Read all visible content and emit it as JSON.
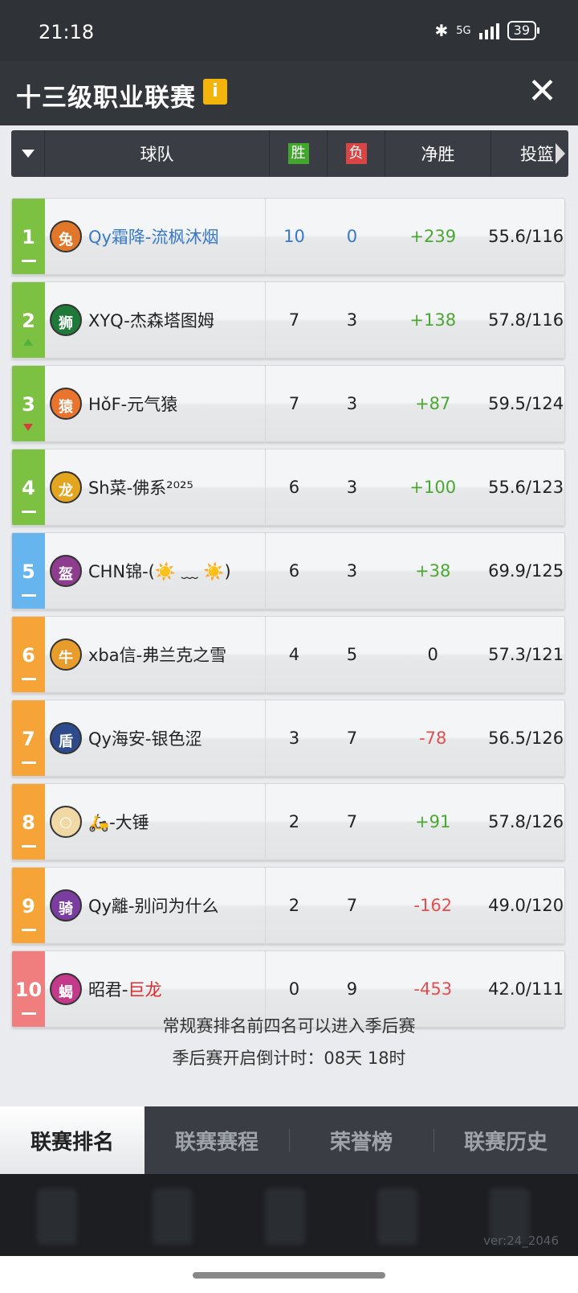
{
  "status": {
    "time": "21:18",
    "network": "5G",
    "battery": "39"
  },
  "header": {
    "title": "十三级职业联赛",
    "info_label": "i"
  },
  "table_header": {
    "team": "球队",
    "win": "胜",
    "loss": "负",
    "net": "净胜",
    "shoot": "投篮"
  },
  "teams": [
    {
      "rank": "1",
      "name": "Qy霜降-流枫沐烟",
      "name_suffix": "",
      "win": "10",
      "loss": "0",
      "net": "+239",
      "shoot": "55.6/116",
      "rank_color": "green",
      "trend": "same",
      "logo_color": "#e0772b",
      "logo_glyph": "兔"
    },
    {
      "rank": "2",
      "name": "XYQ-杰森塔图姆",
      "name_suffix": "",
      "win": "7",
      "loss": "3",
      "net": "+138",
      "shoot": "57.8/116",
      "rank_color": "green",
      "trend": "up",
      "logo_color": "#1f7a3a",
      "logo_glyph": "狮"
    },
    {
      "rank": "3",
      "name": "HǒF-元气猿",
      "name_suffix": "",
      "win": "7",
      "loss": "3",
      "net": "+87",
      "shoot": "59.5/124",
      "rank_color": "green",
      "trend": "down",
      "logo_color": "#e8742e",
      "logo_glyph": "猿"
    },
    {
      "rank": "4",
      "name": "Sh菜-佛系²⁰²⁵",
      "name_suffix": "",
      "win": "6",
      "loss": "3",
      "net": "+100",
      "shoot": "55.6/123",
      "rank_color": "green",
      "trend": "same",
      "logo_color": "#e3a51f",
      "logo_glyph": "龙"
    },
    {
      "rank": "5",
      "name": "CHN锦-(☀️ ﹏ ☀️)",
      "name_suffix": "",
      "win": "6",
      "loss": "3",
      "net": "+38",
      "shoot": "69.9/125",
      "rank_color": "blue",
      "trend": "same",
      "logo_color": "#8e3c8e",
      "logo_glyph": "盔"
    },
    {
      "rank": "6",
      "name": "xba信-弗兰克之雪",
      "name_suffix": "",
      "win": "4",
      "loss": "5",
      "net": "0",
      "shoot": "57.3/121",
      "rank_color": "orange",
      "trend": "same",
      "logo_color": "#e89c2c",
      "logo_glyph": "牛"
    },
    {
      "rank": "7",
      "name": "Qy海安-银色涩",
      "name_suffix": "",
      "win": "3",
      "loss": "7",
      "net": "-78",
      "shoot": "56.5/126",
      "rank_color": "orange",
      "trend": "same",
      "logo_color": "#2d4a8c",
      "logo_glyph": "盾"
    },
    {
      "rank": "8",
      "name": "🛵-大锤",
      "name_suffix": "",
      "win": "2",
      "loss": "7",
      "net": "+91",
      "shoot": "57.8/126",
      "rank_color": "orange",
      "trend": "same",
      "logo_color": "#f1d9a6",
      "logo_glyph": "○"
    },
    {
      "rank": "9",
      "name": "Qy離-别问为什么",
      "name_suffix": "",
      "win": "2",
      "loss": "7",
      "net": "-162",
      "shoot": "49.0/120",
      "rank_color": "orange",
      "trend": "same",
      "logo_color": "#7b3ea0",
      "logo_glyph": "骑"
    },
    {
      "rank": "10",
      "name": "昭君-",
      "name_suffix": "巨龙",
      "win": "0",
      "loss": "9",
      "net": "-453",
      "shoot": "42.0/111",
      "rank_color": "red",
      "trend": "same",
      "logo_color": "#c23a8a",
      "logo_glyph": "蝎"
    }
  ],
  "notes": {
    "line1": "常规赛排名前四名可以进入季后赛",
    "line2": "季后赛开启倒计时：08天 18时"
  },
  "tabs": [
    "联赛排名",
    "联赛赛程",
    "荣誉榜",
    "联赛历史"
  ],
  "version": "ver:24_2046"
}
